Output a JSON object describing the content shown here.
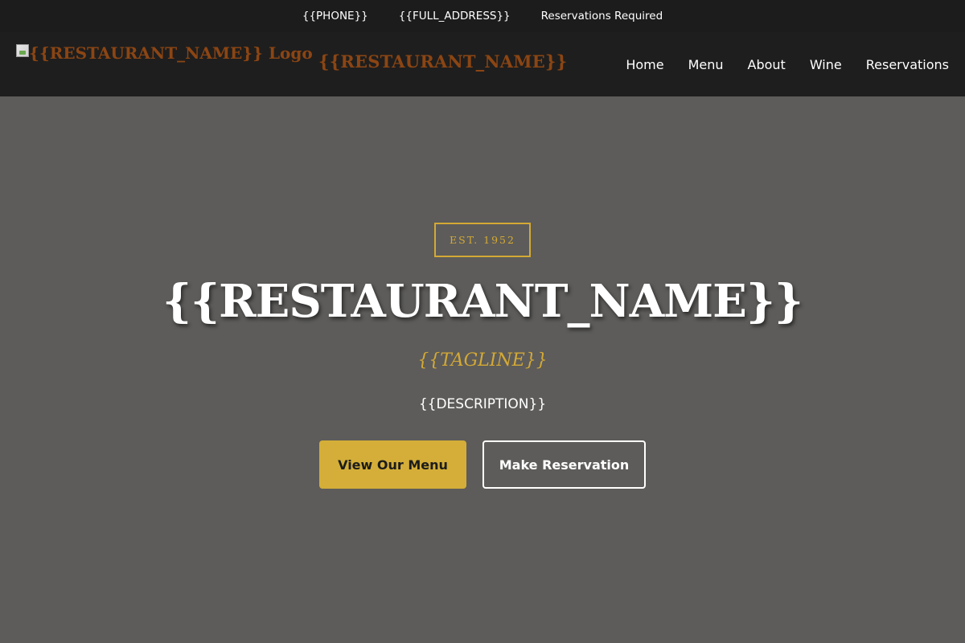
{
  "topbar": {
    "phone": "{{PHONE}}",
    "address": "{{FULL_ADDRESS}}",
    "notice": "Reservations Required"
  },
  "header": {
    "logo_alt": "{{RESTAURANT_NAME}} Logo",
    "brand_name": "{{RESTAURANT_NAME}}",
    "nav": {
      "items": [
        {
          "label": "Home"
        },
        {
          "label": "Menu"
        },
        {
          "label": "About"
        },
        {
          "label": "Wine"
        },
        {
          "label": "Reservations"
        }
      ]
    }
  },
  "hero": {
    "badge": "EST. 1952",
    "title": "{{RESTAURANT_NAME}}",
    "tagline": "{{TAGLINE}}",
    "description": "{{DESCRIPTION}}",
    "primary_button": "View Our Menu",
    "secondary_button": "Make Reservation"
  },
  "colors": {
    "accent_gold": "#d4ae38",
    "brand_brown": "#8b4513",
    "header_dark": "#1e1e1e",
    "hero_bg": "#5d5c5a"
  },
  "icons": {
    "logo": "broken-image-icon"
  }
}
